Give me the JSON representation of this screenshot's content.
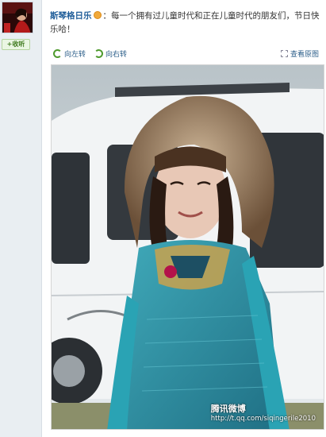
{
  "user": {
    "name": "斯琴格日乐",
    "follow_label": "+收听"
  },
  "post": {
    "text_before": "：每一个拥有过儿童时代和正在儿童时代的朋友们，节日快乐哈！"
  },
  "toolbar": {
    "rotate_left": "向左转",
    "rotate_right": "向右转",
    "view_original": "查看原图"
  },
  "photo": {
    "watermark_brand": "腾讯微博",
    "watermark_url": "http://t.qq.com/siqingerile2010"
  },
  "colors": {
    "link": "#1f5d99",
    "accent_green": "#4e9a2d"
  }
}
